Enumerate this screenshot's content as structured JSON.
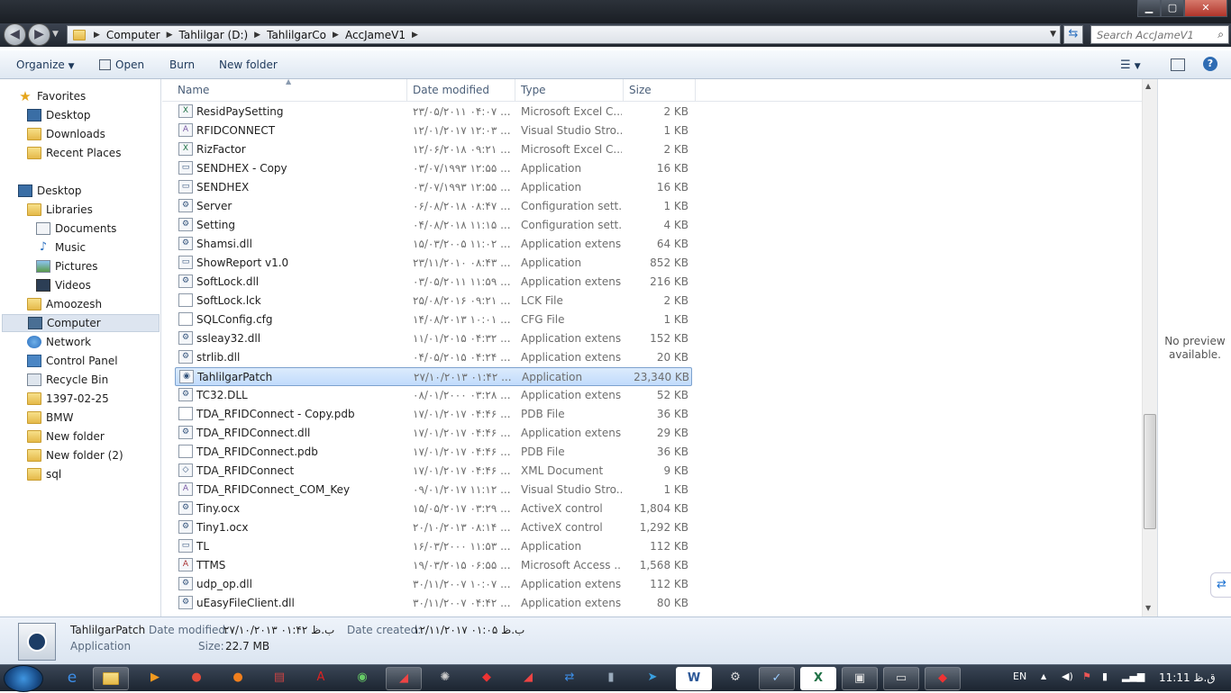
{
  "window": {
    "minimize_label": "▁",
    "maximize_label": "▢",
    "close_label": "✕"
  },
  "address": {
    "crumbs": [
      "Computer",
      "Tahlilgar (D:)",
      "TahlilgarCo",
      "AccJameV1"
    ],
    "search_placeholder": "Search AccJameV1"
  },
  "toolbar": {
    "organize": "Organize",
    "open": "Open",
    "burn": "Burn",
    "new_folder": "New folder"
  },
  "nav": {
    "favorites": "Favorites",
    "favorites_items": [
      "Desktop",
      "Downloads",
      "Recent Places"
    ],
    "desktop": "Desktop",
    "libraries": "Libraries",
    "library_items": [
      "Documents",
      "Music",
      "Pictures",
      "Videos"
    ],
    "other_items": [
      "Amoozesh",
      "Computer",
      "Network",
      "Control Panel",
      "Recycle Bin",
      "1397-02-25",
      "BMW",
      "New folder",
      "New folder (2)",
      "sql"
    ]
  },
  "columns": {
    "name": "Name",
    "date": "Date modified",
    "type": "Type",
    "size": "Size"
  },
  "files": [
    {
      "name": "ResidPaySetting",
      "date": "۲۳/۰۵/۲۰۱۱ ۰۴:۰۷ ...",
      "type": "Microsoft Excel C...",
      "size": "2 KB",
      "icon": "excel-icon"
    },
    {
      "name": "RFIDCONNECT",
      "date": "۱۲/۰۱/۲۰۱۷ ۱۲:۰۳ ...",
      "type": "Visual Studio Stro...",
      "size": "1 KB",
      "icon": "vs-icon"
    },
    {
      "name": "RizFactor",
      "date": "۱۲/۰۶/۲۰۱۸ ۰۹:۲۱ ...",
      "type": "Microsoft Excel C...",
      "size": "2 KB",
      "icon": "excel-icon"
    },
    {
      "name": "SENDHEX - Copy",
      "date": "۰۳/۰۷/۱۹۹۳ ۱۲:۵۵ ...",
      "type": "Application",
      "size": "16 KB",
      "icon": "app-icon"
    },
    {
      "name": "SENDHEX",
      "date": "۰۳/۰۷/۱۹۹۳ ۱۲:۵۵ ...",
      "type": "Application",
      "size": "16 KB",
      "icon": "app-icon"
    },
    {
      "name": "Server",
      "date": "۰۶/۰۸/۲۰۱۸ ۰۸:۴۷ ...",
      "type": "Configuration sett...",
      "size": "1 KB",
      "icon": "config-icon"
    },
    {
      "name": "Setting",
      "date": "۰۴/۰۸/۲۰۱۸ ۱۱:۱۵ ...",
      "type": "Configuration sett...",
      "size": "4 KB",
      "icon": "config-icon"
    },
    {
      "name": "Shamsi.dll",
      "date": "۱۵/۰۳/۲۰۰۵ ۱۱:۰۲ ...",
      "type": "Application extens...",
      "size": "64 KB",
      "icon": "dll-icon"
    },
    {
      "name": "ShowReport v1.0",
      "date": "۲۳/۱۱/۲۰۱۰ ۰۸:۴۳ ...",
      "type": "Application",
      "size": "852 KB",
      "icon": "app-icon"
    },
    {
      "name": "SoftLock.dll",
      "date": "۰۳/۰۵/۲۰۱۱ ۱۱:۵۹ ...",
      "type": "Application extens...",
      "size": "216 KB",
      "icon": "dll-icon"
    },
    {
      "name": "SoftLock.lck",
      "date": "۲۵/۰۸/۲۰۱۶ ۰۹:۲۱ ...",
      "type": "LCK File",
      "size": "2 KB",
      "icon": "file-icon"
    },
    {
      "name": "SQLConfig.cfg",
      "date": "۱۴/۰۸/۲۰۱۳ ۱۰:۰۱ ...",
      "type": "CFG File",
      "size": "1 KB",
      "icon": "file-icon"
    },
    {
      "name": "ssleay32.dll",
      "date": "۱۱/۰۱/۲۰۱۵ ۰۴:۳۲ ...",
      "type": "Application extens...",
      "size": "152 KB",
      "icon": "dll-icon"
    },
    {
      "name": "strlib.dll",
      "date": "۰۴/۰۵/۲۰۱۵ ۰۴:۲۴ ...",
      "type": "Application extens...",
      "size": "20 KB",
      "icon": "dll-icon"
    },
    {
      "name": "TahlilgarPatch",
      "date": "۲۷/۱۰/۲۰۱۳ ۰۱:۴۲ ...",
      "type": "Application",
      "size": "23,340 KB",
      "icon": "patch-icon",
      "selected": true
    },
    {
      "name": "TC32.DLL",
      "date": "۰۸/۰۱/۲۰۰۰ ۰۳:۲۸ ...",
      "type": "Application extens...",
      "size": "52 KB",
      "icon": "dll-icon"
    },
    {
      "name": "TDA_RFIDConnect - Copy.pdb",
      "date": "۱۷/۰۱/۲۰۱۷ ۰۴:۴۶ ...",
      "type": "PDB File",
      "size": "36 KB",
      "icon": "file-icon"
    },
    {
      "name": "TDA_RFIDConnect.dll",
      "date": "۱۷/۰۱/۲۰۱۷ ۰۴:۴۶ ...",
      "type": "Application extens...",
      "size": "29 KB",
      "icon": "dll-icon"
    },
    {
      "name": "TDA_RFIDConnect.pdb",
      "date": "۱۷/۰۱/۲۰۱۷ ۰۴:۴۶ ...",
      "type": "PDB File",
      "size": "36 KB",
      "icon": "file-icon"
    },
    {
      "name": "TDA_RFIDConnect",
      "date": "۱۷/۰۱/۲۰۱۷ ۰۴:۴۶ ...",
      "type": "XML Document",
      "size": "9 KB",
      "icon": "xml-icon"
    },
    {
      "name": "TDA_RFIDConnect_COM_Key",
      "date": "۰۹/۰۱/۲۰۱۷ ۱۱:۱۲ ...",
      "type": "Visual Studio Stro...",
      "size": "1 KB",
      "icon": "vs-icon"
    },
    {
      "name": "Tiny.ocx",
      "date": "۱۵/۰۵/۲۰۱۷ ۰۳:۲۹ ...",
      "type": "ActiveX control",
      "size": "1,804 KB",
      "icon": "dll-icon"
    },
    {
      "name": "Tiny1.ocx",
      "date": "۲۰/۱۰/۲۰۱۳ ۰۸:۱۴ ...",
      "type": "ActiveX control",
      "size": "1,292 KB",
      "icon": "dll-icon"
    },
    {
      "name": "TL",
      "date": "۱۶/۰۳/۲۰۰۰ ۱۱:۵۳ ...",
      "type": "Application",
      "size": "112 KB",
      "icon": "app-icon"
    },
    {
      "name": "TTMS",
      "date": "۱۹/۰۳/۲۰۱۵ ۰۶:۵۵ ...",
      "type": "Microsoft Access ...",
      "size": "1,568 KB",
      "icon": "access-icon"
    },
    {
      "name": "udp_op.dll",
      "date": "۳۰/۱۱/۲۰۰۷ ۱۰:۰۷ ...",
      "type": "Application extens...",
      "size": "112 KB",
      "icon": "dll-icon"
    },
    {
      "name": "uEasyFileClient.dll",
      "date": "۳۰/۱۱/۲۰۰۷ ۰۴:۴۲ ...",
      "type": "Application extens...",
      "size": "80 KB",
      "icon": "dll-icon"
    }
  ],
  "preview": {
    "text": "No preview available."
  },
  "details": {
    "name": "TahlilgarPatch",
    "type": "Application",
    "date_modified_label": "Date modified:",
    "date_modified": "۲۷/۱۰/۲۰۱۳ ب.ظ ۰۱:۴۲",
    "date_created_label": "Date created:",
    "date_created": "۱۲/۱۱/۲۰۱۷ ب.ظ ۰۱:۰۵",
    "size_label": "Size:",
    "size": "22.7 MB"
  },
  "taskbar": {
    "language": "EN",
    "clock": "11:11 ق.ظ"
  }
}
